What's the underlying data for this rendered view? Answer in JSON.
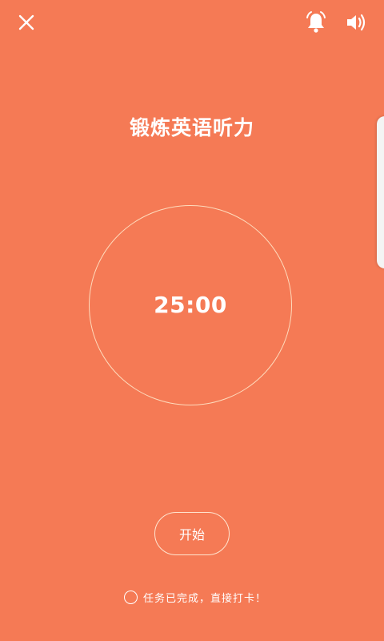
{
  "header": {
    "close_icon": "close-icon",
    "bell_icon": "bell-icon",
    "sound_icon": "volume-icon"
  },
  "task": {
    "title": "锻炼英语听力"
  },
  "timer": {
    "value": "25:00"
  },
  "controls": {
    "start_label": "开始"
  },
  "checkin": {
    "label": "任务已完成，直接打卡！"
  },
  "colors": {
    "background": "#F57A55",
    "foreground": "#FFFFFF"
  }
}
